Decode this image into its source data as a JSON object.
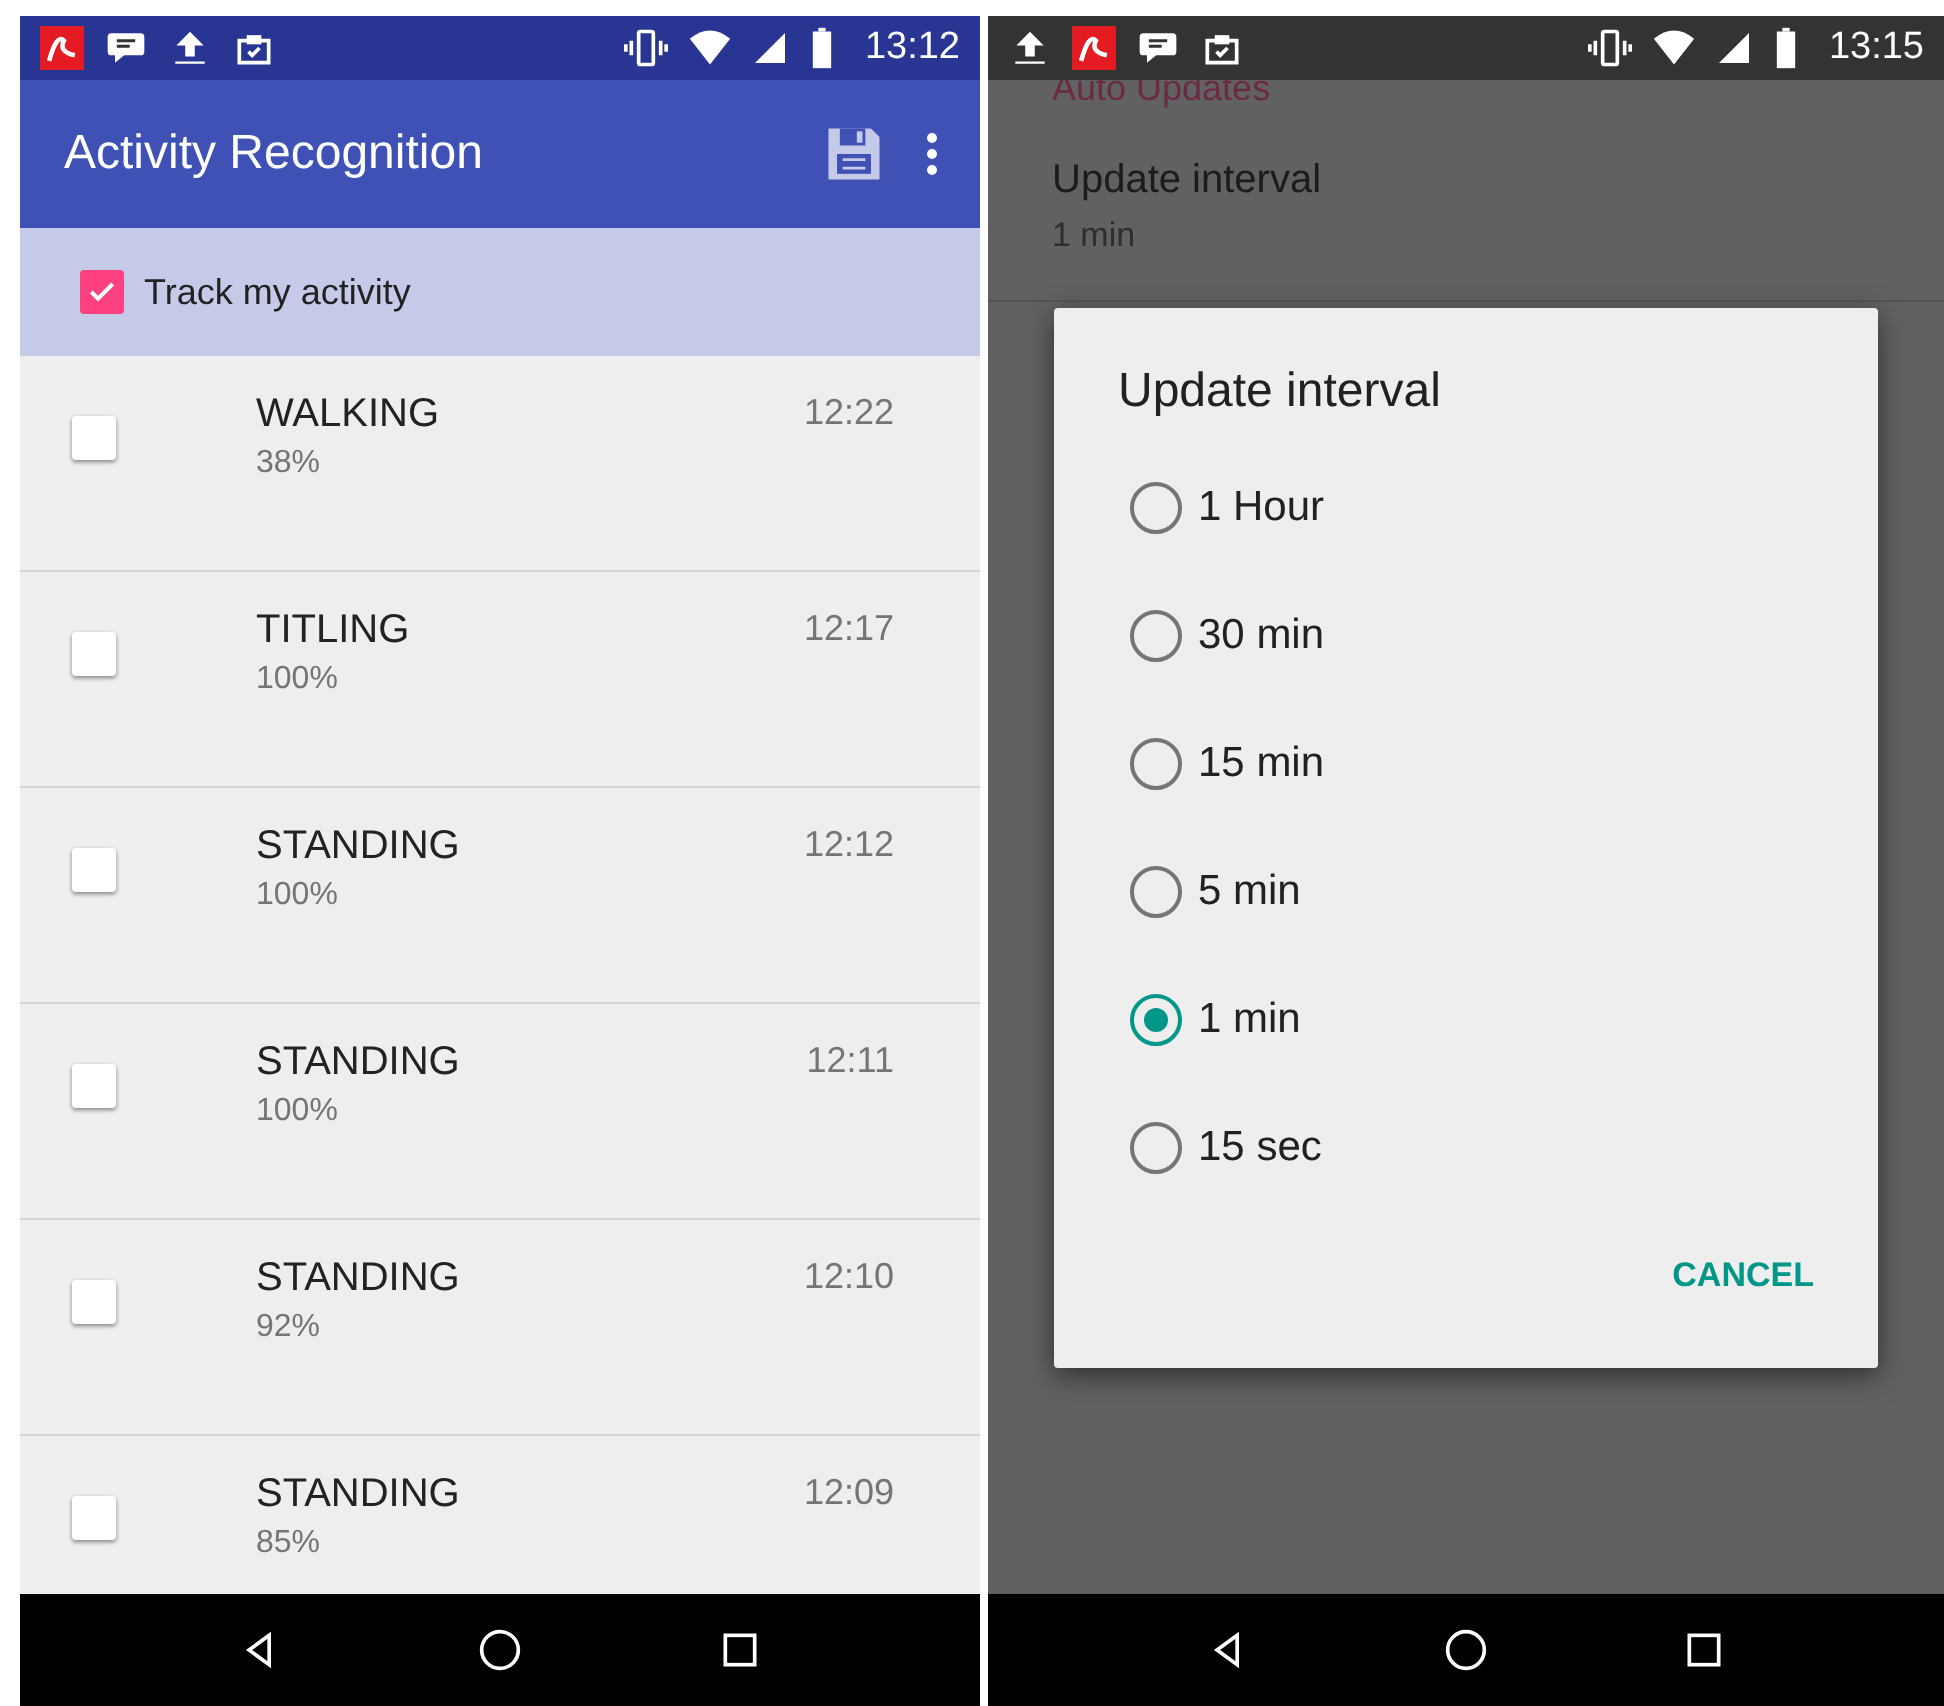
{
  "left_screen": {
    "status_bar": {
      "time": "13:12"
    },
    "app_bar": {
      "title": "Activity Recognition"
    },
    "track_toggle": {
      "label": "Track my activity",
      "checked": true
    },
    "activities": [
      {
        "name": "WALKING",
        "confidence": "38%",
        "time": "12:22",
        "checked": false
      },
      {
        "name": "TITLING",
        "confidence": "100%",
        "time": "12:17",
        "checked": false
      },
      {
        "name": "STANDING",
        "confidence": "100%",
        "time": "12:12",
        "checked": false
      },
      {
        "name": "STANDING",
        "confidence": "100%",
        "time": "12:11",
        "checked": false
      },
      {
        "name": "STANDING",
        "confidence": "92%",
        "time": "12:10",
        "checked": false
      },
      {
        "name": "STANDING",
        "confidence": "85%",
        "time": "12:09",
        "checked": false
      }
    ]
  },
  "right_screen": {
    "status_bar": {
      "time": "13:15"
    },
    "settings": {
      "category": "Auto Updates",
      "item_title": "Update interval",
      "item_summary": "1 min"
    },
    "dialog": {
      "title": "Update interval",
      "options": [
        {
          "label": "1 Hour",
          "selected": false
        },
        {
          "label": "30 min",
          "selected": false
        },
        {
          "label": "15 min",
          "selected": false
        },
        {
          "label": "5 min",
          "selected": false
        },
        {
          "label": "1 min",
          "selected": true
        },
        {
          "label": "15 sec",
          "selected": false
        }
      ],
      "cancel": "CANCEL"
    }
  }
}
